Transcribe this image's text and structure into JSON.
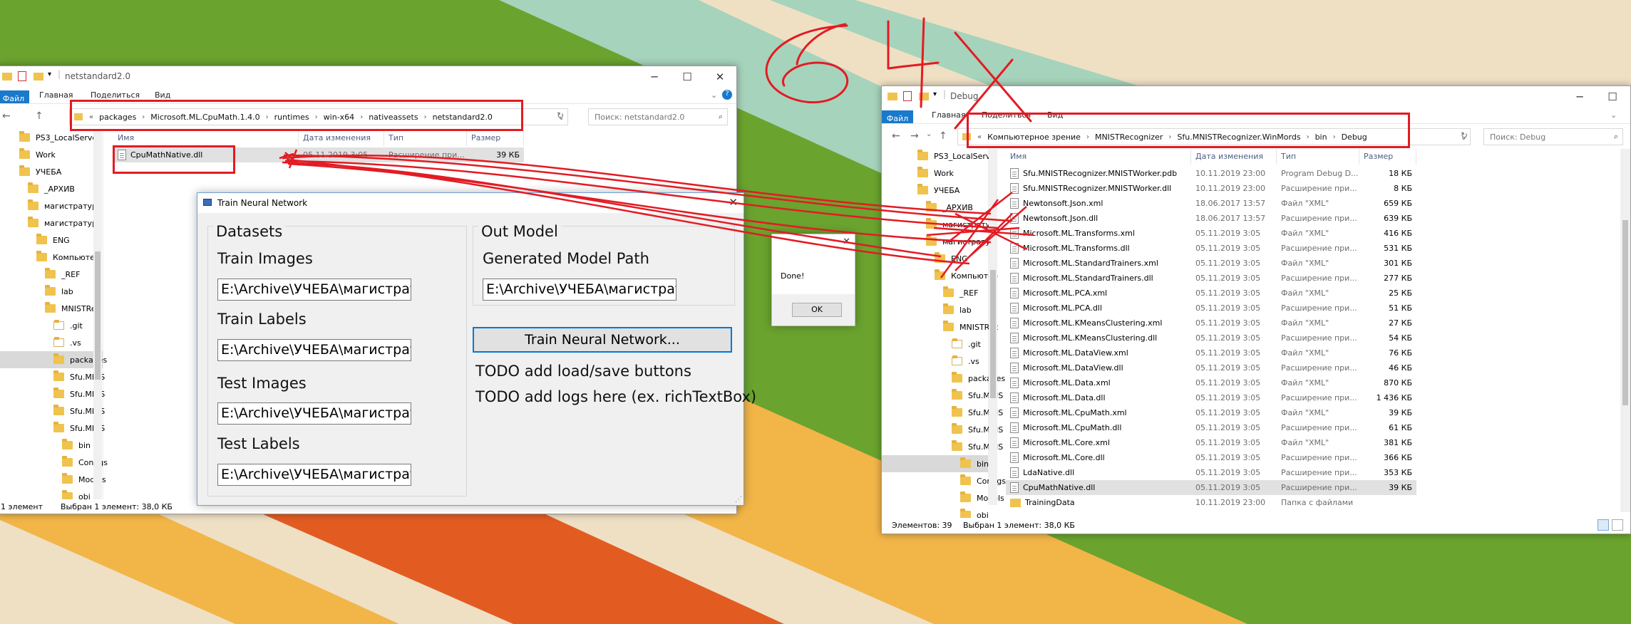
{
  "handwriting": "6 4 x",
  "colors": {
    "annotation_red": "#e31b23",
    "ribbon_blue": "#1979ca",
    "folder_yellow": "#f0c34f"
  },
  "left_explorer": {
    "title": "netstandard2.0",
    "ribbon": [
      "Файл",
      "Главная",
      "Поделиться",
      "Вид"
    ],
    "address": [
      "packages",
      "Microsoft.ML.CpuMath.1.4.0",
      "runtimes",
      "win-x64",
      "nativeassets",
      "netstandard2.0"
    ],
    "search_placeholder": "Поиск: netstandard2.0",
    "tree": [
      "PS3_LocalServe",
      "Work",
      "УЧЕБА",
      "_АРХИВ",
      "магистратур",
      "магистратур",
      "ENG",
      "Компьютер",
      "_REF",
      "lab",
      "MNISTRec",
      ".git",
      ".vs",
      "packages",
      "Sfu.MNIS",
      "Sfu.MNIS",
      "Sfu.MNIS",
      "Sfu.MNIS",
      "bin",
      "Configs",
      "Models",
      "obj"
    ],
    "columns": [
      "Имя",
      "Дата изменения",
      "Тип",
      "Размер"
    ],
    "files": [
      {
        "name": "CpuMathNative.dll",
        "date": "05.11.2019 3:05",
        "type": "Расширение при...",
        "size": "39 КБ"
      }
    ],
    "status_count": "1 элемент",
    "status_selected": "Выбран 1 элемент: 38,0 КБ"
  },
  "dialog": {
    "title": "Train Neural Network",
    "datasets_label": "Datasets",
    "out_model_label": "Out Model",
    "train_images_label": "Train Images",
    "train_images_value": "E:\\Archive\\УЧЕБА\\магистратура",
    "train_labels_label": "Train Labels",
    "train_labels_value": "E:\\Archive\\УЧЕБА\\магистратура",
    "test_images_label": "Test Images",
    "test_images_value": "E:\\Archive\\УЧЕБА\\магистратура",
    "test_labels_label": "Test Labels",
    "test_labels_value": "E:\\Archive\\УЧЕБА\\магистратура",
    "model_path_label": "Generated Model Path",
    "model_path_value": "E:\\Archive\\УЧЕБА\\магистратура",
    "train_button": "Train Neural Network...",
    "todo1": "TODO add load/save buttons",
    "todo2": "TODO add logs here (ex. richTextBox)"
  },
  "messagebox": {
    "text": "Done!",
    "ok": "OK"
  },
  "right_explorer": {
    "title": "Debug",
    "ribbon": [
      "Файл",
      "Главная",
      "Поделиться",
      "Вид"
    ],
    "address": [
      "Компьютерное зрение",
      "MNISTRecognizer",
      "Sfu.MNISTRecognizer.WinMords",
      "bin",
      "Debug"
    ],
    "search_placeholder": "Поиск: Debug",
    "tree": [
      "PS3_LocalServe",
      "Work",
      "УЧЕБА",
      "_АРХИВ",
      "магистрату",
      "магистрату",
      "ENG",
      "Компьютер",
      "_REF",
      "lab",
      "MNISTRec",
      ".git",
      ".vs",
      "packages",
      "Sfu.MNIS",
      "Sfu.MNIS",
      "Sfu.MNIS",
      "Sfu.MNIS",
      "bin",
      "Configs",
      "Models",
      "obj"
    ],
    "columns": [
      "Имя",
      "Дата изменения",
      "Тип",
      "Размер"
    ],
    "files": [
      {
        "name": "Sfu.MNISTRecognizer.MNISTWorker.pdb",
        "date": "10.11.2019 23:00",
        "type": "Program Debug D...",
        "size": "18 КБ",
        "kind": "doc"
      },
      {
        "name": "Sfu.MNISTRecognizer.MNISTWorker.dll",
        "date": "10.11.2019 23:00",
        "type": "Расширение при...",
        "size": "8 КБ",
        "kind": "doc"
      },
      {
        "name": "Newtonsoft.Json.xml",
        "date": "18.06.2017 13:57",
        "type": "Файл \"XML\"",
        "size": "659 КБ",
        "kind": "doc"
      },
      {
        "name": "Newtonsoft.Json.dll",
        "date": "18.06.2017 13:57",
        "type": "Расширение при...",
        "size": "639 КБ",
        "kind": "doc"
      },
      {
        "name": "Microsoft.ML.Transforms.xml",
        "date": "05.11.2019 3:05",
        "type": "Файл \"XML\"",
        "size": "416 КБ",
        "kind": "doc"
      },
      {
        "name": "Microsoft.ML.Transforms.dll",
        "date": "05.11.2019 3:05",
        "type": "Расширение при...",
        "size": "531 КБ",
        "kind": "doc"
      },
      {
        "name": "Microsoft.ML.StandardTrainers.xml",
        "date": "05.11.2019 3:05",
        "type": "Файл \"XML\"",
        "size": "301 КБ",
        "kind": "doc"
      },
      {
        "name": "Microsoft.ML.StandardTrainers.dll",
        "date": "05.11.2019 3:05",
        "type": "Расширение при...",
        "size": "277 КБ",
        "kind": "doc"
      },
      {
        "name": "Microsoft.ML.PCA.xml",
        "date": "05.11.2019 3:05",
        "type": "Файл \"XML\"",
        "size": "25 КБ",
        "kind": "doc"
      },
      {
        "name": "Microsoft.ML.PCA.dll",
        "date": "05.11.2019 3:05",
        "type": "Расширение при...",
        "size": "51 КБ",
        "kind": "doc"
      },
      {
        "name": "Microsoft.ML.KMeansClustering.xml",
        "date": "05.11.2019 3:05",
        "type": "Файл \"XML\"",
        "size": "27 КБ",
        "kind": "doc"
      },
      {
        "name": "Microsoft.ML.KMeansClustering.dll",
        "date": "05.11.2019 3:05",
        "type": "Расширение при...",
        "size": "54 КБ",
        "kind": "doc"
      },
      {
        "name": "Microsoft.ML.DataView.xml",
        "date": "05.11.2019 3:05",
        "type": "Файл \"XML\"",
        "size": "76 КБ",
        "kind": "doc"
      },
      {
        "name": "Microsoft.ML.DataView.dll",
        "date": "05.11.2019 3:05",
        "type": "Расширение при...",
        "size": "46 КБ",
        "kind": "doc"
      },
      {
        "name": "Microsoft.ML.Data.xml",
        "date": "05.11.2019 3:05",
        "type": "Файл \"XML\"",
        "size": "870 КБ",
        "kind": "doc"
      },
      {
        "name": "Microsoft.ML.Data.dll",
        "date": "05.11.2019 3:05",
        "type": "Расширение при...",
        "size": "1 436 КБ",
        "kind": "doc"
      },
      {
        "name": "Microsoft.ML.CpuMath.xml",
        "date": "05.11.2019 3:05",
        "type": "Файл \"XML\"",
        "size": "39 КБ",
        "kind": "doc"
      },
      {
        "name": "Microsoft.ML.CpuMath.dll",
        "date": "05.11.2019 3:05",
        "type": "Расширение при...",
        "size": "61 КБ",
        "kind": "doc"
      },
      {
        "name": "Microsoft.ML.Core.xml",
        "date": "05.11.2019 3:05",
        "type": "Файл \"XML\"",
        "size": "381 КБ",
        "kind": "doc"
      },
      {
        "name": "Microsoft.ML.Core.dll",
        "date": "05.11.2019 3:05",
        "type": "Расширение при...",
        "size": "366 КБ",
        "kind": "doc"
      },
      {
        "name": "LdaNative.dll",
        "date": "05.11.2019 3:05",
        "type": "Расширение при...",
        "size": "353 КБ",
        "kind": "doc"
      },
      {
        "name": "CpuMathNative.dll",
        "date": "05.11.2019 3:05",
        "type": "Расширение при...",
        "size": "39 КБ",
        "kind": "doc",
        "selected": true
      },
      {
        "name": "TrainingData",
        "date": "10.11.2019 23:00",
        "type": "Папка с файлами",
        "size": "",
        "kind": "folder"
      }
    ],
    "status_count": "Элементов: 39",
    "status_selected": "Выбран 1 элемент: 38,0 КБ"
  }
}
